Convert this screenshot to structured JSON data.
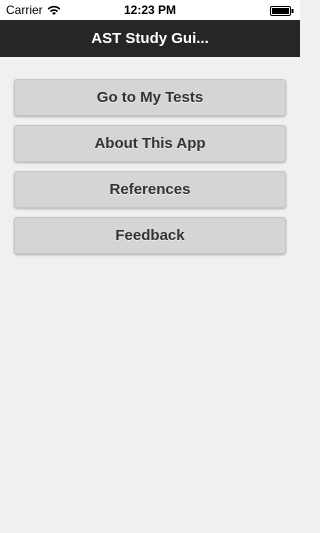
{
  "status_bar": {
    "carrier": "Carrier",
    "time": "12:23 PM",
    "icons": [
      "wifi-icon",
      "battery-icon"
    ]
  },
  "nav": {
    "title": "AST Study Gui..."
  },
  "menu": {
    "items": [
      {
        "label": "Go to My Tests"
      },
      {
        "label": "About This App"
      },
      {
        "label": "References"
      },
      {
        "label": "Feedback"
      }
    ]
  },
  "colors": {
    "nav_background": "#262626",
    "page_background": "#f0f0f0",
    "button_background": "#d5d5d5",
    "button_text": "#333333"
  }
}
